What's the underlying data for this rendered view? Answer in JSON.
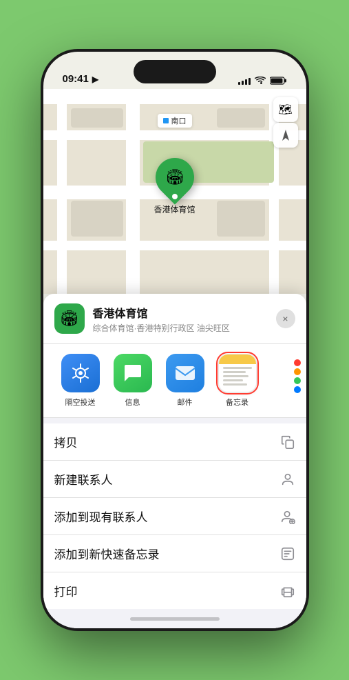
{
  "status": {
    "time": "09:41",
    "location_arrow": "▶",
    "signal": [
      3,
      5,
      7,
      9,
      11
    ],
    "wifi": "wifi",
    "battery": "battery"
  },
  "map": {
    "label_tag": "南口",
    "controls": {
      "layers_icon": "🗺",
      "location_icon": "⬆"
    }
  },
  "marker": {
    "label": "香港体育馆"
  },
  "venue": {
    "name": "香港体育馆",
    "subtitle": "综合体育馆·香港特别行政区 油尖旺区"
  },
  "share_items": [
    {
      "id": "airdrop",
      "label": "隔空投送",
      "type": "airdrop"
    },
    {
      "id": "message",
      "label": "信息",
      "type": "message"
    },
    {
      "id": "mail",
      "label": "邮件",
      "type": "mail"
    },
    {
      "id": "notes",
      "label": "备忘录",
      "type": "notes",
      "selected": true
    }
  ],
  "actions": [
    {
      "id": "copy",
      "label": "拷贝",
      "icon": "⊙"
    },
    {
      "id": "add-contact",
      "label": "新建联系人",
      "icon": "👤"
    },
    {
      "id": "add-to-contact",
      "label": "添加到现有联系人",
      "icon": "👤"
    },
    {
      "id": "add-quick-note",
      "label": "添加到新快速备忘录",
      "icon": "⬛"
    },
    {
      "id": "print",
      "label": "打印",
      "icon": "🖨"
    }
  ],
  "close_label": "×",
  "home_indicator": true
}
